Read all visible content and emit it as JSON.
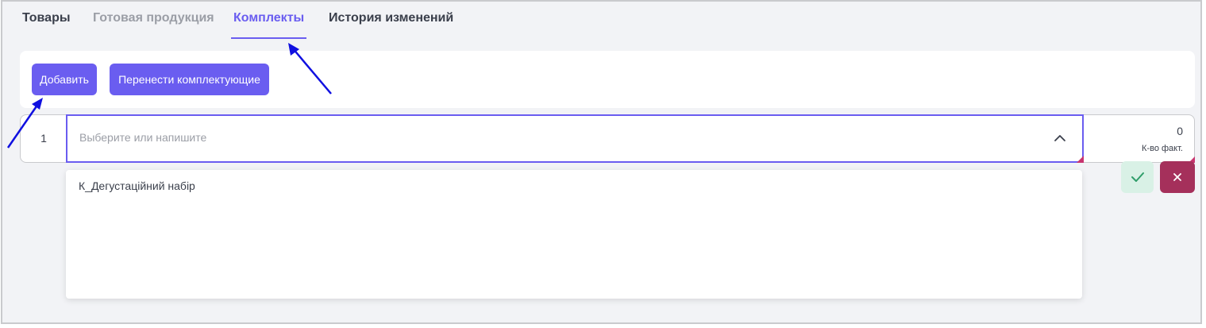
{
  "tabs": [
    {
      "label": "Товары",
      "state": "normal"
    },
    {
      "label": "Готовая продукция",
      "state": "disabled"
    },
    {
      "label": "Комплекты",
      "state": "active"
    },
    {
      "label": "История изменений",
      "state": "normal"
    }
  ],
  "toolbar": {
    "add_label": "Добавить",
    "move_label": "Перенести комплектующие"
  },
  "row": {
    "number": "1",
    "select_placeholder": "Выберите или напишите",
    "qty_value": "0",
    "qty_label": "К-во факт."
  },
  "dropdown": {
    "options": [
      "К_Дегустаційний набір"
    ]
  },
  "icons": {
    "select_toggle": "chevron-up-icon",
    "confirm": "check-icon",
    "cancel": "close-icon"
  },
  "colors": {
    "accent": "#6a5df0",
    "confirm_bg": "#d9f1e6",
    "confirm_fg": "#2f9e6a",
    "cancel_bg": "#a5305b",
    "annotation_arrow": "#1010e0"
  }
}
